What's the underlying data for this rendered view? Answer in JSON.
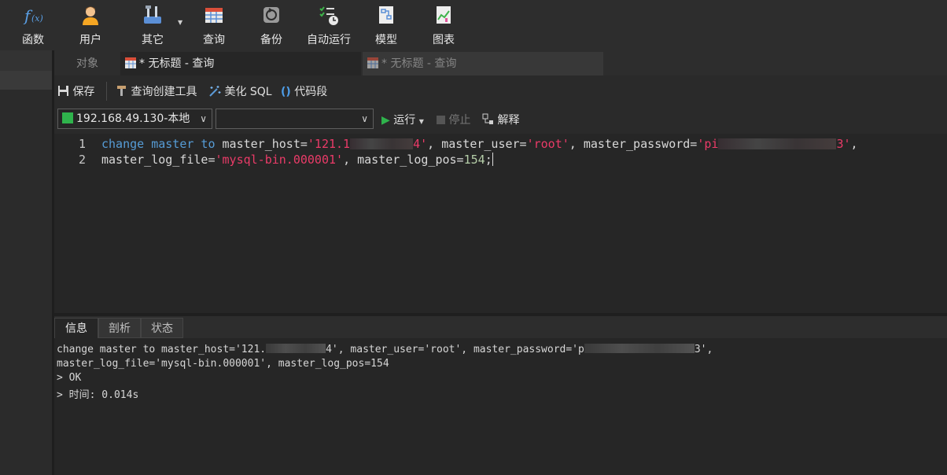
{
  "toolbar": {
    "items": [
      {
        "label": "函数",
        "icon": "function-icon"
      },
      {
        "label": "用户",
        "icon": "user-icon"
      },
      {
        "label": "其它",
        "icon": "tools-icon"
      },
      {
        "label": "查询",
        "icon": "query-grid-icon"
      },
      {
        "label": "备份",
        "icon": "backup-icon"
      },
      {
        "label": "自动运行",
        "icon": "auto-run-icon"
      },
      {
        "label": "模型",
        "icon": "model-icon"
      },
      {
        "label": "图表",
        "icon": "chart-icon"
      }
    ]
  },
  "tabs": {
    "objects": "对象",
    "active": "* 无标题 - 查询",
    "inactive": "* 无标题 - 查询"
  },
  "subtoolbar": {
    "save": "保存",
    "query_builder": "查询创建工具",
    "beautify": "美化 SQL",
    "snippet": "代码段"
  },
  "connection": {
    "selected": "192.168.49.130-本地",
    "database": "",
    "run": "运行",
    "stop": "停止",
    "explain": "解释"
  },
  "editor": {
    "line_numbers": [
      "1",
      "2"
    ],
    "line1": {
      "kw": "change master to",
      "p1": " master_host=",
      "s1a": "'121.1",
      "s1b": "4'",
      "p2": ", master_user=",
      "s2": "'root'",
      "p3": ", master_password=",
      "s3a": "'pi",
      "s3b": "3'",
      "p4": ","
    },
    "line2": {
      "p1": "master_log_file=",
      "s1": "'mysql-bin.000001'",
      "p2": ", master_log_pos=",
      "num": "154",
      "p3": ";"
    }
  },
  "result_tabs": [
    "信息",
    "剖析",
    "状态"
  ],
  "results": {
    "line1a": "change master to master_host='121.",
    "line1b": "4', master_user='root', master_password='p",
    "line1c": "3',",
    "line2": "master_log_file='mysql-bin.000001', master_log_pos=154",
    "line3": "> OK",
    "line4": "> 时间: 0.014s"
  },
  "colors": {
    "keyword": "#569cd6",
    "string": "#ea3b68",
    "number": "#b5cea8",
    "run_green": "#2fb34c"
  }
}
